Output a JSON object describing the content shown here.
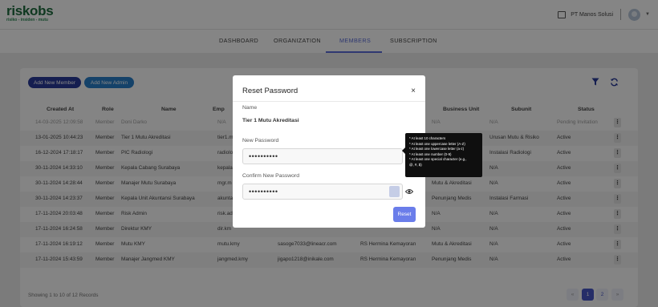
{
  "header": {
    "logo": "riskobs",
    "tagline": "risiko - insiden - mutu",
    "company": "PT Manos Solusi"
  },
  "nav": {
    "tabs": [
      "DASHBOARD",
      "ORGANIZATION",
      "MEMBERS",
      "SUBSCRIPTION"
    ],
    "active": "MEMBERS"
  },
  "toolbar": {
    "add_member": "Add New Member",
    "add_admin": "Add New Admin"
  },
  "table": {
    "columns": [
      "Created At",
      "Role",
      "Name",
      "Emp",
      "Business Unit",
      "Subunit",
      "Status"
    ],
    "rows": [
      {
        "created": "14-03-2025 12:09:58",
        "role": "Member",
        "name": "Doni Darko",
        "emp": "N/A",
        "email": "",
        "unit": "",
        "bu": "N/A",
        "sub": "N/A",
        "status": "Pending Invitation"
      },
      {
        "created": "13-01-2025 10:44:23",
        "role": "Member",
        "name": "Tier 1 Mutu Akreditasi",
        "emp": "tier1.m",
        "email": "",
        "unit": "",
        "bu": "",
        "sub": "Urusan Mutu & Risiko",
        "status": "Active"
      },
      {
        "created": "16-12-2024 17:18:17",
        "role": "Member",
        "name": "PIC Radiologi",
        "emp": "radiolo",
        "email": "",
        "unit": "",
        "bu": "",
        "sub": "Instalasi Radiologi",
        "status": "Active"
      },
      {
        "created": "30-11-2024 14:33:10",
        "role": "Member",
        "name": "Kepala Cabang Surabaya",
        "emp": "kepala",
        "email": "",
        "unit": "",
        "bu": "",
        "sub": "N/A",
        "status": "Active"
      },
      {
        "created": "30-11-2024 14:28:44",
        "role": "Member",
        "name": "Manajer Mutu Surabaya",
        "emp": "mgr.m",
        "email": "",
        "unit": "",
        "bu": "Mutu & Akreditasi",
        "sub": "N/A",
        "status": "Active"
      },
      {
        "created": "30-11-2024 14:23:37",
        "role": "Member",
        "name": "Kepala Unit Akuntansi Surabaya",
        "emp": "akunta",
        "email": "",
        "unit": "",
        "bu": "Penunjang Medis",
        "sub": "Instalasi Farmasi",
        "status": "Active"
      },
      {
        "created": "17-11-2024 20:03:48",
        "role": "Member",
        "name": "Risk Admin",
        "emp": "risk.ad",
        "email": "",
        "unit": "",
        "bu": "N/A",
        "sub": "N/A",
        "status": "Active"
      },
      {
        "created": "17-11-2024 16:24:58",
        "role": "Member",
        "name": "Direktur KMY",
        "emp": "dir.km",
        "email": "",
        "unit": "",
        "bu": "N/A",
        "sub": "N/A",
        "status": "Active"
      },
      {
        "created": "17-11-2024 16:19:12",
        "role": "Member",
        "name": "Mutu KMY",
        "emp": "mutu.kmy",
        "email": "sasoge7033@lineacr.com",
        "unit": "RS Hermina Kemayoran",
        "bu": "Mutu & Akreditasi",
        "sub": "N/A",
        "status": "Active"
      },
      {
        "created": "17-11-2024 15:43:59",
        "role": "Member",
        "name": "Manajer Jangmed KMY",
        "emp": "jangmed.kmy",
        "email": "jigapo1218@inikale.com",
        "unit": "RS Hermina Kemayoran",
        "bu": "Penunjang Medis",
        "sub": "N/A",
        "status": "Active"
      }
    ],
    "kebab": "⋮"
  },
  "footer": {
    "records": "Showing 1 to 10 of 12 Records",
    "pages": [
      "«",
      "1",
      "2",
      "»"
    ]
  },
  "modal": {
    "title": "Reset Password",
    "close": "×",
    "name_label": "Name",
    "name_value": "Tier 1 Mutu Akreditasi",
    "new_password_label": "New Password",
    "new_password_value": "••••••••••",
    "confirm_password_label": "Confirm New Password",
    "confirm_password_value": "••••••••••",
    "reset_label": "Reset"
  },
  "tooltip": {
    "lines": [
      "* At least 10 characters",
      "* At least one uppercase letter (A-Z)",
      "* At least one lowercase letter (a-z)",
      "* At least one number (0-9)",
      "* At least one special character (e.g.,",
      "@, #, $)"
    ]
  },
  "colors": {
    "brand": "#1d6b3f",
    "accent": "#5a6cd8",
    "primary_button": "#6a7dea"
  }
}
